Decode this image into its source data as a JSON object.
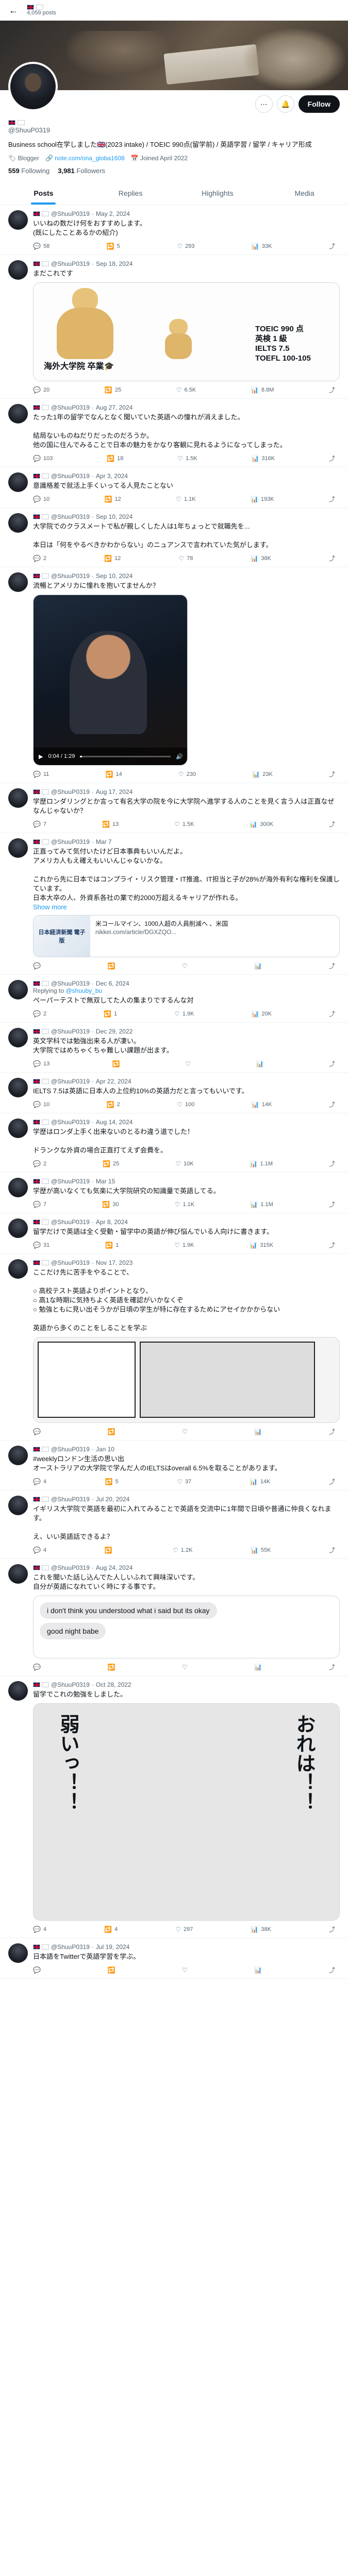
{
  "header": {
    "back_icon": "←",
    "name": "🇬🇧 🇯🇵",
    "posts_count": "4,059 posts"
  },
  "profile": {
    "name_flags": "🇬🇧 🇯🇵",
    "handle": "@ShuuP0319",
    "bio": "Business school在学しました🇬🇧(2023 intake) / TOEIC 990点(留学前) / 英語学習 / 留学 / キャリア形成",
    "blogger": "Blogger",
    "link": "note.com/ona_globa1608",
    "joined": "Joined April 2022",
    "following_count": "559",
    "following_label": "Following",
    "followers_count": "3,981",
    "followers_label": "Followers",
    "follow_label": "Follow",
    "more_icon": "⋯",
    "notify_icon": "🔔"
  },
  "tabs": [
    "Posts",
    "Replies",
    "Highlights",
    "Media"
  ],
  "posts": [
    {
      "pinned": "",
      "date": "May 2, 2024",
      "text": "いいねの数だけ何をおすすめします。\n(既にしたことあるかの紹介)",
      "stats": [
        "58",
        "5",
        "293",
        "33K",
        ""
      ],
      "media": ""
    },
    {
      "date": "Sep 18, 2024",
      "text": "まだこれです",
      "stats": [
        "20",
        "25",
        "6.5K",
        "8.8M",
        ""
      ],
      "media": "meme",
      "meme_left": "海外大学院 卒業🎓",
      "meme_right": "TOEIC 990 点\n英検 1 級\nIELTS 7.5\nTOEFL 100-105"
    },
    {
      "date": "Aug 27, 2024",
      "text": "たった1年の留学でなんとなく聞いていた英語への憧れが消えました。\n\n結局ないものねだりだったのだろうか。\n他の国に住んでみることで日本の魅力をかなり客観に見れるようになってしまった。",
      "stats": [
        "103",
        "18",
        "1.5K",
        "316K",
        ""
      ],
      "media": ""
    },
    {
      "date": "Apr 3, 2024",
      "text": "意識格差で就活上手くいってる人見たことない",
      "stats": [
        "10",
        "12",
        "1.1K",
        "193K",
        ""
      ],
      "media": ""
    },
    {
      "date": "Sep 10, 2024",
      "text": "大学院でのクラスメートで私が親しくした人は1年ちょっとで就職先を...\n\n本日は「何をやるべきかわからない」のニュアンスで言われていた気がします。",
      "stats": [
        "2",
        "12",
        "78",
        "38K",
        ""
      ],
      "media": ""
    },
    {
      "date": "Sep 10, 2024",
      "text": "流暢とアメリカに憧れを抱いてませんか？",
      "stats": [
        "11",
        "14",
        "230",
        "23K",
        ""
      ],
      "media": "video",
      "video_time": "0:04 / 1:29"
    },
    {
      "date": "Aug 17, 2024",
      "text": "学歴ロンダリングとか言って有名大学の院を今に大学院へ進学する人のことを見く言う人は正直なぜなんじゃないか？",
      "stats": [
        "7",
        "13",
        "1.5K",
        "300K",
        ""
      ],
      "media": ""
    },
    {
      "date": "Mar 7",
      "text": "正直ってみて気付いたけど日本事典もいいんだよ。\nアメリカ人もえ確えもいいんじゃないかな。\n\nこれから先に日本ではコンプライ・リスク管理・IT推進、IT担当と子が28%が海外有利な権利を保護しています。\n日本大卒の人、外資系各社の業で約2000万超えるキャリアが作れる。",
      "stats": [
        "",
        "",
        "",
        "",
        ""
      ],
      "media": "card",
      "card_img": "日本経済新聞 電子版",
      "card_title": "米コールマイン、1000人超の人員削減へ 、米国",
      "card_domain": "nikkei.com/article/DGXZQO..."
    },
    {
      "date": "Dec 6, 2024",
      "replying": "@shuuby_bu",
      "text": "ペーパーテストで無双してた人の集まりでするんな対",
      "stats": [
        "2",
        "1",
        "1.9K",
        "20K",
        ""
      ],
      "media": ""
    },
    {
      "date": "Dec 29, 2022",
      "text": "英文学科では勉強出来る人が凄い。\n大学院ではめちゃくちゃ難しい課題が出ます。",
      "stats": [
        "13",
        "",
        "",
        "",
        ""
      ],
      "media": ""
    },
    {
      "date": "Apr 22, 2024",
      "text": "IELTS 7.5は英語に日本人の上位約10%の英語力だと言ってもいいです。",
      "stats": [
        "10",
        "2",
        "100",
        "14K",
        ""
      ],
      "media": ""
    },
    {
      "date": "Aug 14, 2024",
      "text": "学歴はロンダ上手く出来ないのとるわ違う道でした！\n\nドランクな外資の場合正直打てえず会費を。",
      "stats": [
        "2",
        "25",
        "10K",
        "1.1M",
        ""
      ],
      "media": ""
    },
    {
      "date": "Mar 15",
      "text": "学歴が高いなくても気楽に大学院研究の知識量で英語してる。",
      "stats": [
        "7",
        "30",
        "1.1K",
        "1.1M",
        ""
      ],
      "media": ""
    },
    {
      "date": "Apr 8, 2024",
      "text": "留学だけで英語は全く受動・留学中の英語が伸び悩んでいる人向けに書きます。",
      "stats": [
        "31",
        "1",
        "1.9K",
        "315K",
        ""
      ],
      "media": ""
    },
    {
      "date": "Nov 17, 2023",
      "text": "ここだけ先に苦手をやることで、\n\n○ 高校テスト英語よりポイントとなり、\n○ 高1な時期に気持ちよく英語を確認がいかなくぞ\n○ 勉強ともに見い出そうかが日頃の学生が特に存在するためにアセイかかからない\n\n英語から多くのことをしることを学ぶ",
      "stats": [
        "",
        "",
        "",
        "",
        ""
      ],
      "media": "manga1"
    },
    {
      "date": "Jan 10",
      "text": "#weeklyロンドン生活の思い出\nオーストラリアの大学院で学んだ人のIELTSはoverall 6.5%を取ることがあります。",
      "stats": [
        "4",
        "5",
        "37",
        "14K",
        ""
      ],
      "media": ""
    },
    {
      "date": "Jul 20, 2024",
      "text": "イギリス大学院で英語を最初に入れてみることで英語を交流中に1年間で日頃や普通に仲良くなれます。\n\nえ、いい英語話できるよ？",
      "stats": [
        "4",
        "",
        "1.2K",
        "55K",
        ""
      ],
      "media": ""
    },
    {
      "date": "Aug 24, 2024",
      "text": "これを聞いた話し込んでた人しいふれて興味深いです。\n自分が英語になれていく時にする事です。",
      "stats": [
        "",
        "",
        "",
        "",
        ""
      ],
      "media": "chat",
      "bubble1": "i don't think you understood what i said but its okay",
      "bubble2": "good night babe"
    },
    {
      "date": "Oct 28, 2022",
      "text": "留学でこれの勉強をしました。",
      "stats": [
        "4",
        "4",
        "297",
        "38K",
        ""
      ],
      "media": "manga2",
      "manga2_a": "弱いっ！！",
      "manga2_b": "おれは！！"
    },
    {
      "date": "Jul 19, 2024",
      "text": "日本語をTwitterで英語学習を学ぶ。",
      "stats": [
        "",
        "",
        "",
        "",
        ""
      ],
      "media": ""
    }
  ],
  "icons": {
    "reply": "💬",
    "repost": "🔁",
    "like": "♡",
    "views": "📊",
    "share": "⤴"
  },
  "colors": {
    "accent": "#1d9bf0",
    "text": "#0f1419",
    "muted": "#536471"
  }
}
